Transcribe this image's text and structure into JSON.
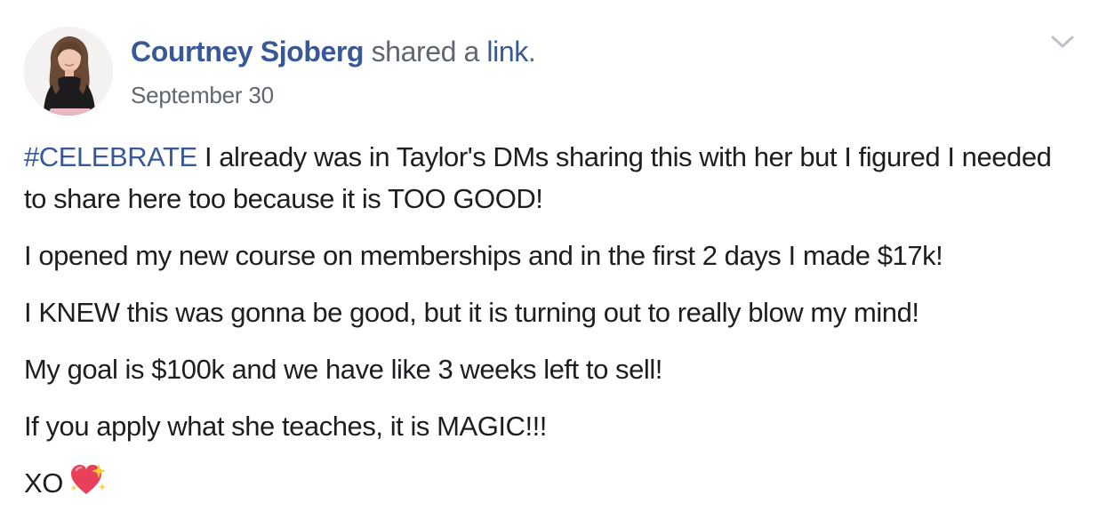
{
  "post": {
    "author_name": "Courtney Sjoberg",
    "action_text": "shared a",
    "link_text": "link",
    "period": ".",
    "timestamp": "September 30",
    "hashtag": "#CELEBRATE",
    "paragraph_1_rest": " I already was in Taylor's DMs sharing this with her but I figured I needed to share here too because it is TOO GOOD!",
    "paragraph_2": "I opened my new course on memberships and in the first 2 days I made $17k!",
    "paragraph_3": "I KNEW this was gonna be good, but it is turning out to really blow my mind!",
    "paragraph_4": "My goal is $100k and we have like 3 weeks left to sell!",
    "paragraph_5": "If you apply what she teaches, it is MAGIC!!!",
    "signoff": "XO"
  },
  "icons": {
    "menu": "chevron-down-icon",
    "avatar": "profile-photo",
    "emoji": "sparkling-heart-emoji"
  },
  "colors": {
    "link_blue": "#385898",
    "text": "#1c1e21",
    "meta_gray": "#606770",
    "heart": "#e8405a"
  }
}
